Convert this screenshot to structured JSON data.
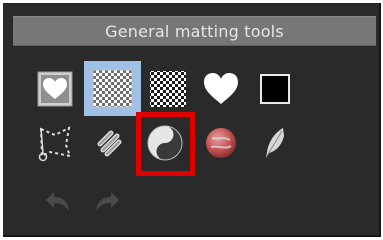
{
  "panel": {
    "title": "General matting tools"
  },
  "tools": [
    {
      "name": "heart-frame-icon"
    },
    {
      "name": "transparency-grid-icon",
      "selected": true
    },
    {
      "name": "checkerboard-icon"
    },
    {
      "name": "white-heart-icon"
    },
    {
      "name": "black-square-icon"
    },
    {
      "name": "lasso-selection-icon"
    },
    {
      "name": "chain-link-icon"
    },
    {
      "name": "yin-yang-icon",
      "highlighted": true
    },
    {
      "name": "red-sphere-icon"
    },
    {
      "name": "feather-icon"
    },
    {
      "name": "undo-icon",
      "disabled": true
    },
    {
      "name": "redo-icon",
      "disabled": true
    }
  ],
  "colors": {
    "panel_bg": "#2a2a2a",
    "title_bar_bg": "#777777",
    "title_text": "#e6e6e6",
    "selected_bg": "#9fc1e5",
    "highlight_border": "#e00000"
  }
}
